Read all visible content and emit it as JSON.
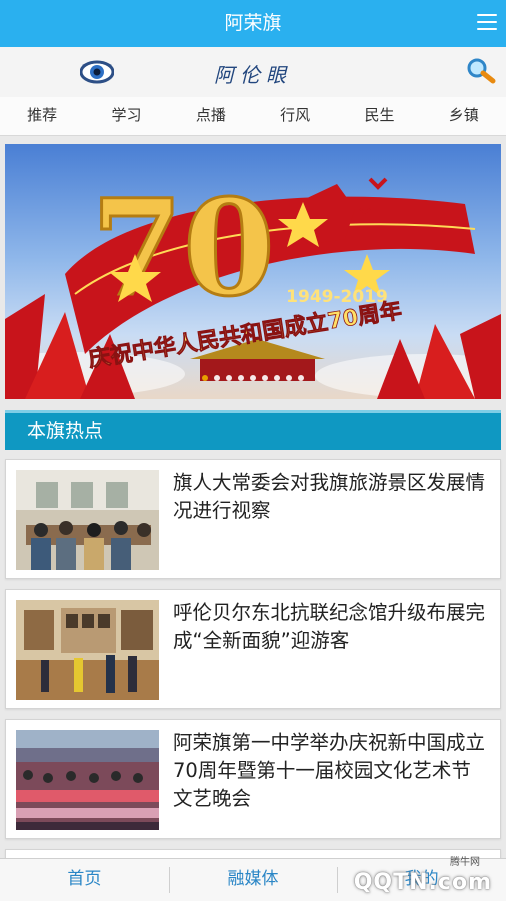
{
  "app": {
    "title": "阿荣旗"
  },
  "brand": {
    "name": "阿伦眼"
  },
  "nav": {
    "tabs": [
      "推荐",
      "学习",
      "点播",
      "行风",
      "民生",
      "乡镇"
    ]
  },
  "banner": {
    "numeral": "70",
    "years": "1949-2019",
    "slogan": "庆祝中华人民共和国成立70周年",
    "dot_count": 9,
    "active_dot": 0
  },
  "section": {
    "title": "本旗热点"
  },
  "news": [
    {
      "headline": "旗人大常委会对我旗旅游景区发展情况进行视察"
    },
    {
      "headline": "呼伦贝尔东北抗联纪念馆升级布展完成“全新面貌”迎游客"
    },
    {
      "headline": "阿荣旗第一中学举办庆祝新中国成立70周年暨第十一届校园文化艺术节文艺晚会"
    }
  ],
  "bottom_tabs": [
    "首页",
    "融媒体",
    "我的"
  ],
  "watermark": {
    "site": "腾牛网",
    "logo": "QQTN.com"
  },
  "colors": {
    "titlebar": "#2ab0ef",
    "section": "#0f98c2",
    "bottom_text": "#2a86c6"
  }
}
